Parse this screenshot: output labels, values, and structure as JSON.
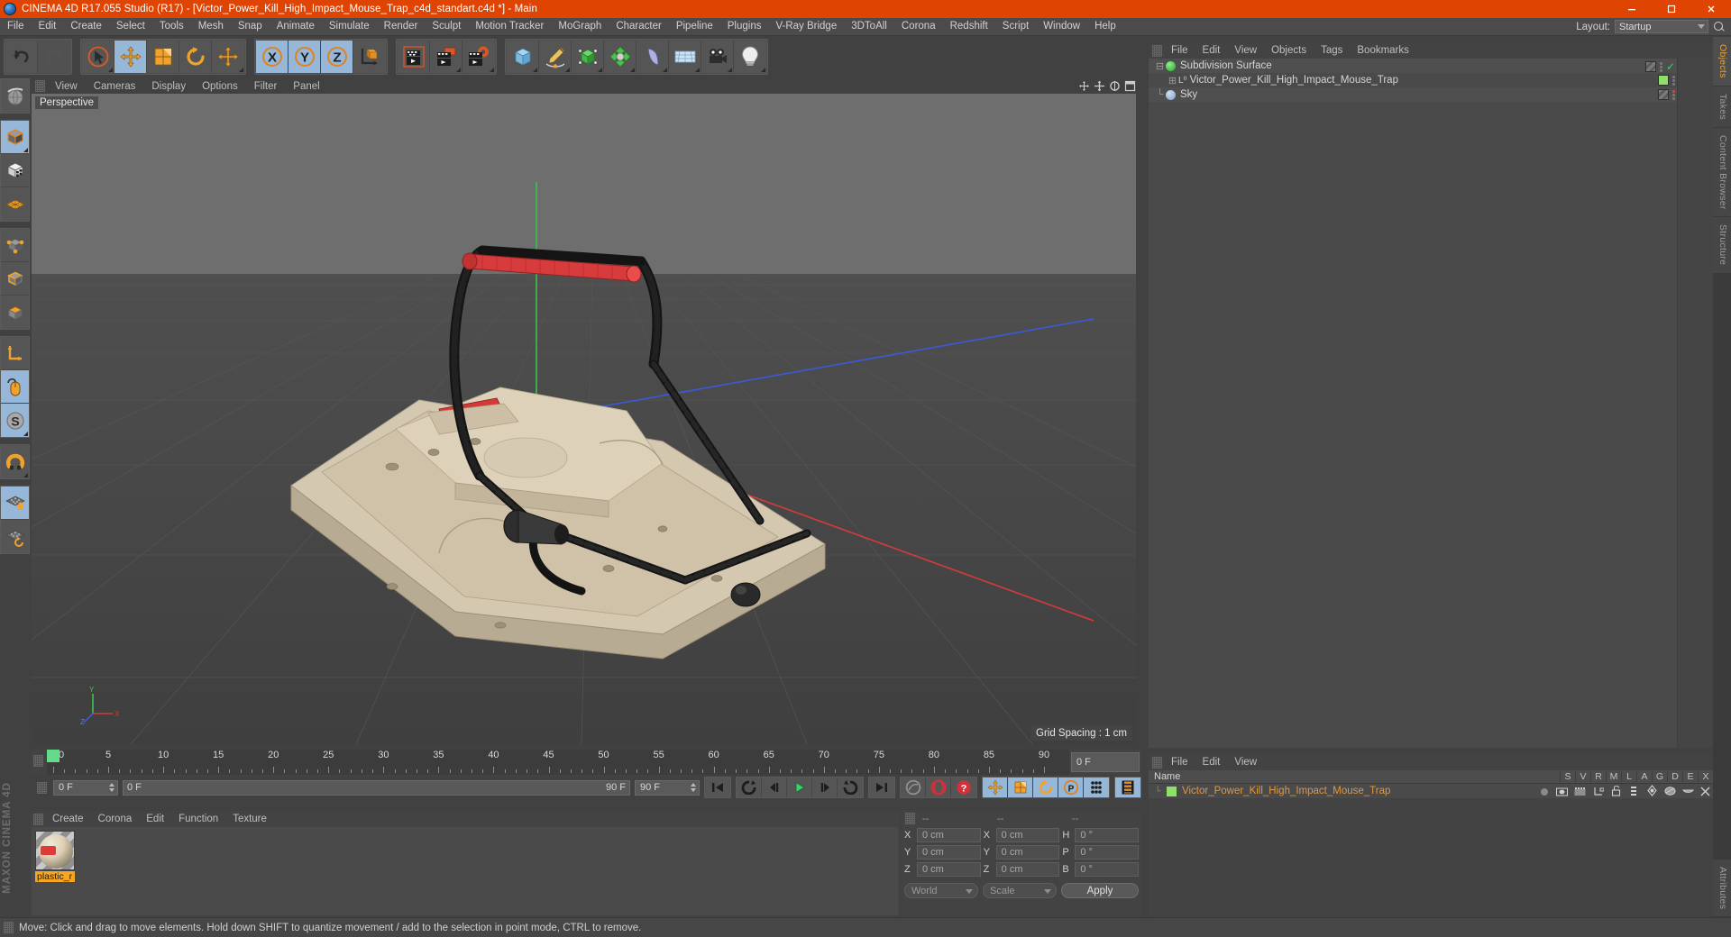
{
  "window": {
    "title": "CINEMA 4D R17.055 Studio (R17) - [Victor_Power_Kill_High_Impact_Mouse_Trap_c4d_standart.c4d *] - Main",
    "logo": "c4d-logo-icon",
    "minimize": "minimize-icon",
    "maximize": "maximize-icon",
    "close": "close-icon",
    "titlebar_color": "#e04403"
  },
  "menubar": {
    "items": [
      "File",
      "Edit",
      "Create",
      "Select",
      "Tools",
      "Mesh",
      "Snap",
      "Animate",
      "Simulate",
      "Render",
      "Sculpt",
      "Motion Tracker",
      "MoGraph",
      "Character",
      "Pipeline",
      "Plugins",
      "V-Ray Bridge",
      "3DToAll",
      "Corona",
      "Redshift",
      "Script",
      "Window",
      "Help"
    ],
    "layout_label": "Layout:",
    "layout_value": "Startup",
    "search_icon": "search-icon"
  },
  "toolbar": {
    "groups": [
      {
        "buttons": [
          {
            "name": "undo-icon",
            "state": "normal"
          },
          {
            "name": "redo-icon",
            "state": "disabled"
          }
        ]
      },
      {
        "buttons": [
          {
            "name": "live-selection-icon",
            "state": "normal"
          },
          {
            "name": "move-tool-icon",
            "state": "active"
          },
          {
            "name": "scale-tool-icon",
            "state": "normal"
          },
          {
            "name": "rotate-tool-icon",
            "state": "normal"
          },
          {
            "name": "move-duplicate-icon",
            "state": "normal"
          }
        ]
      },
      {
        "buttons": [
          {
            "name": "lock-x-axis-icon",
            "state": "active"
          },
          {
            "name": "lock-y-axis-icon",
            "state": "active"
          },
          {
            "name": "lock-z-axis-icon",
            "state": "active"
          },
          {
            "name": "world-object-coordinate-icon",
            "state": "normal"
          }
        ]
      },
      {
        "buttons": [
          {
            "name": "render-view-icon",
            "state": "normal"
          },
          {
            "name": "render-to-picture-viewer-icon",
            "state": "normal"
          },
          {
            "name": "render-settings-icon",
            "state": "normal"
          }
        ]
      },
      {
        "buttons": [
          {
            "name": "add-cube-primitive-icon",
            "state": "normal"
          },
          {
            "name": "add-spline-pen-icon",
            "state": "normal"
          },
          {
            "name": "add-generator-icon",
            "state": "normal"
          },
          {
            "name": "add-mograph-icon",
            "state": "normal"
          },
          {
            "name": "add-deformer-icon",
            "state": "normal"
          },
          {
            "name": "add-scene-environment-icon",
            "state": "normal"
          },
          {
            "name": "add-camera-icon",
            "state": "normal"
          },
          {
            "name": "add-light-icon",
            "state": "normal"
          }
        ]
      }
    ]
  },
  "left_palette": {
    "groups": [
      {
        "buttons": [
          {
            "name": "undo-view-globe-icon",
            "state": "normal"
          }
        ]
      },
      {
        "buttons": [
          {
            "name": "model-mode-icon",
            "state": "active"
          },
          {
            "name": "texture-mode-icon",
            "state": "normal"
          },
          {
            "name": "polygon-grid-mode-icon",
            "state": "normal"
          }
        ]
      },
      {
        "buttons": [
          {
            "name": "points-mode-icon",
            "state": "normal"
          },
          {
            "name": "edges-mode-icon",
            "state": "normal"
          },
          {
            "name": "polygons-mode-icon",
            "state": "normal"
          }
        ]
      },
      {
        "buttons": [
          {
            "name": "axis-mode-icon",
            "state": "normal"
          },
          {
            "name": "enable-axis-mouse-icon",
            "state": "active"
          },
          {
            "name": "soft-selection-icon",
            "state": "active"
          }
        ]
      },
      {
        "buttons": [
          {
            "name": "snap-magnet-icon",
            "state": "normal"
          }
        ]
      },
      {
        "buttons": [
          {
            "name": "workplane-lock-icon",
            "state": "active"
          },
          {
            "name": "workplane-rotate-icon",
            "state": "normal"
          }
        ]
      }
    ],
    "brand": "MAXON CINEMA 4D"
  },
  "viewport": {
    "menu": [
      "View",
      "Cameras",
      "Display",
      "Options",
      "Filter",
      "Panel"
    ],
    "label": "Perspective",
    "grid_spacing": "Grid Spacing : 1 cm",
    "nav_icons": [
      "move-view-icon",
      "scale-view-icon",
      "rotate-view-icon",
      "maximize-view-icon"
    ],
    "axis_gizmo": {
      "x": "X",
      "y": "Y",
      "z": "Z"
    },
    "scene_description": "3D mouse trap model - Victor Power Kill High Impact",
    "colors": {
      "sky": "#6b6b6b",
      "ground": "#474747",
      "model_body": "#d8cdb6",
      "model_wire": "#1c1c1c",
      "model_accent": "#d83b3b",
      "axis_x": "#cf3b3b",
      "axis_y": "#44c049",
      "axis_z": "#3b54cf"
    }
  },
  "timeline": {
    "ticks": [
      "0",
      "5",
      "10",
      "15",
      "20",
      "25",
      "30",
      "35",
      "40",
      "45",
      "50",
      "55",
      "60",
      "65",
      "70",
      "75",
      "80",
      "85",
      "90"
    ],
    "current_frame_marker": "0",
    "end_field": "0 F"
  },
  "playback": {
    "current_frame": "0 F",
    "range_start": "0 F",
    "range_end": "90 F",
    "preview_end": "90 F",
    "buttons": [
      {
        "name": "go-to-start-button",
        "glyph": "go-to-start-icon"
      },
      {
        "name": "previous-keyframe-button",
        "glyph": "previous-keyframe-icon"
      },
      {
        "name": "step-back-button",
        "glyph": "step-back-icon"
      },
      {
        "name": "play-button",
        "glyph": "play-icon"
      },
      {
        "name": "step-forward-button",
        "glyph": "step-forward-icon"
      },
      {
        "name": "next-keyframe-button",
        "glyph": "next-keyframe-icon"
      },
      {
        "name": "go-to-end-button",
        "glyph": "go-to-end-icon"
      },
      {
        "name": "autokeying-button",
        "glyph": "autokeying-icon"
      },
      {
        "name": "record-active-objects-button",
        "glyph": "record-icon"
      },
      {
        "name": "keyframe-selection-button",
        "glyph": "keyframe-selection-icon"
      },
      {
        "name": "position-key-button",
        "glyph": "position-key-icon"
      },
      {
        "name": "scale-key-button",
        "glyph": "scale-key-icon"
      },
      {
        "name": "rotation-key-button",
        "glyph": "rotation-key-icon"
      },
      {
        "name": "param-key-button",
        "glyph": "param-key-icon"
      },
      {
        "name": "point-level-animation-button",
        "glyph": "pla-icon"
      },
      {
        "name": "timeline-filmstrip-button",
        "glyph": "filmstrip-icon"
      }
    ]
  },
  "material_manager": {
    "menu": [
      "Create",
      "Corona",
      "Edit",
      "Function",
      "Texture"
    ],
    "materials": [
      {
        "name": "plastic_r",
        "thumb": "material-sphere-thumbnail"
      }
    ]
  },
  "coordinates": {
    "headers": [
      "--",
      "--",
      "--"
    ],
    "rows": [
      {
        "l1": "X",
        "v1": "0 cm",
        "l2": "X",
        "v2": "0 cm",
        "l3": "H",
        "v3": "0 °"
      },
      {
        "l1": "Y",
        "v1": "0 cm",
        "l2": "Y",
        "v2": "0 cm",
        "l3": "P",
        "v3": "0 °"
      },
      {
        "l1": "Z",
        "v1": "0 cm",
        "l2": "Z",
        "v2": "0 cm",
        "l3": "B",
        "v3": "0 °"
      }
    ],
    "system": "World",
    "mode": "Scale",
    "apply": "Apply"
  },
  "object_manager": {
    "menu": [
      "File",
      "Edit",
      "View",
      "Objects",
      "Tags",
      "Bookmarks"
    ],
    "rows": [
      {
        "label": "Subdivision Surface",
        "icon": "subdivision-surface-icon",
        "color": "#4fd64f",
        "tag": "hatched-tag",
        "check": "✓",
        "indent": 0
      },
      {
        "label": "Victor_Power_Kill_High_Impact_Mouse_Trap",
        "icon": "polygon-object-icon",
        "color": "#8fd44f",
        "tag": "green-tag",
        "check": "",
        "indent": 1
      },
      {
        "label": "Sky",
        "icon": "sky-object-icon",
        "color": "#9fb6d8",
        "tag": "hatched-tag",
        "check": "",
        "indent": 0
      }
    ]
  },
  "attributes": {
    "menu": [
      "File",
      "Edit",
      "View"
    ],
    "name_header": "Name",
    "columns": [
      "S",
      "V",
      "R",
      "M",
      "L",
      "A",
      "G",
      "D",
      "E",
      "X"
    ],
    "row": {
      "label": "Victor_Power_Kill_High_Impact_Mouse_Trap",
      "color": "#8fd44f",
      "icons": [
        "dot-icon",
        "visible-icon",
        "render-icon",
        "hierarchy-icon",
        "unlock-icon",
        "layer-icon",
        "generator-icon",
        "deformer-icon",
        "cap-icon",
        "x-icon"
      ]
    }
  },
  "right_tabs": {
    "items": [
      "Objects",
      "Takes",
      "Content Browser",
      "Structure"
    ],
    "active": "Objects",
    "lower": [
      "Attributes"
    ]
  },
  "statusbar": {
    "text": "Move: Click and drag to move elements. Hold down SHIFT to quantize movement / add to the selection in point mode, CTRL to remove."
  }
}
